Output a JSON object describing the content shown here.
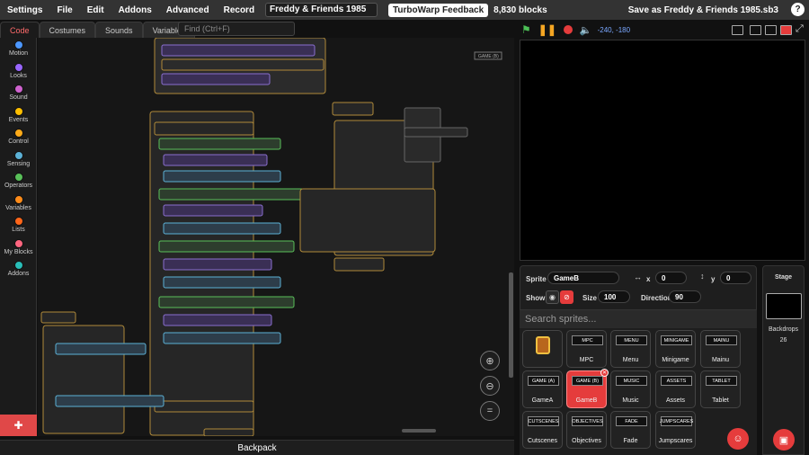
{
  "menubar": {
    "items": [
      "Settings",
      "File",
      "Edit",
      "Addons",
      "Advanced",
      "Record"
    ],
    "project_title": "Freddy & Friends 1985",
    "feedback_label": "TurboWarp Feedback",
    "blocks_count": "8,830 blocks",
    "save_as_label": "Save as Freddy & Friends 1985.sb3",
    "help_label": "?"
  },
  "tabs": [
    "Code",
    "Costumes",
    "Sounds",
    "Variables"
  ],
  "find_placeholder": "Find (Ctrl+F)",
  "categories": [
    {
      "label": "Motion",
      "color": "#4c97ff"
    },
    {
      "label": "Looks",
      "color": "#9966ff"
    },
    {
      "label": "Sound",
      "color": "#cf63cf"
    },
    {
      "label": "Events",
      "color": "#ffbf00"
    },
    {
      "label": "Control",
      "color": "#ffab19"
    },
    {
      "label": "Sensing",
      "color": "#5cb1d6"
    },
    {
      "label": "Operators",
      "color": "#59c059"
    },
    {
      "label": "Variables",
      "color": "#ff8c1a"
    },
    {
      "label": "Lists",
      "color": "#ff661a"
    },
    {
      "label": "My Blocks",
      "color": "#ff6680"
    },
    {
      "label": "Addons",
      "color": "#29beb8"
    }
  ],
  "backpack_label": "Backpack",
  "stage_header": {
    "coords": "-240, -180"
  },
  "sprite_info": {
    "sprite_label": "Sprite",
    "sprite_name": "GameB",
    "x_label": "x",
    "x_value": "0",
    "y_label": "y",
    "y_value": "0",
    "show_label": "Show",
    "size_label": "Size",
    "size_value": "100",
    "direction_label": "Direction",
    "direction_value": "90"
  },
  "search_sprites_placeholder": "Search sprites...",
  "sprites": [
    {
      "name": "",
      "thumb": ""
    },
    {
      "name": "MPC",
      "thumb": "MPC"
    },
    {
      "name": "Menu",
      "thumb": "MENU"
    },
    {
      "name": "Minigame",
      "thumb": "MINIGAME"
    },
    {
      "name": "Mainu",
      "thumb": "MAINU"
    },
    {
      "name": "GameA",
      "thumb": "GAME (A)"
    },
    {
      "name": "GameB",
      "thumb": "GAME (B)"
    },
    {
      "name": "Music",
      "thumb": "MUSIC"
    },
    {
      "name": "Assets",
      "thumb": "ASSETS"
    },
    {
      "name": "Tablet",
      "thumb": "TABLET"
    },
    {
      "name": "Cutscenes",
      "thumb": "CUTSCENES"
    },
    {
      "name": "Objectives",
      "thumb": "OBJECTIVES"
    },
    {
      "name": "Fade",
      "thumb": "FADE"
    },
    {
      "name": "Jumpscares",
      "thumb": "JUMPSCARES"
    }
  ],
  "stage_panel": {
    "title": "Stage",
    "backdrops_label": "Backdrops",
    "backdrops_count": "26"
  },
  "code_comment": "GAME (B)",
  "colors": {
    "accent": "#e53c3c",
    "background": "#111111"
  }
}
